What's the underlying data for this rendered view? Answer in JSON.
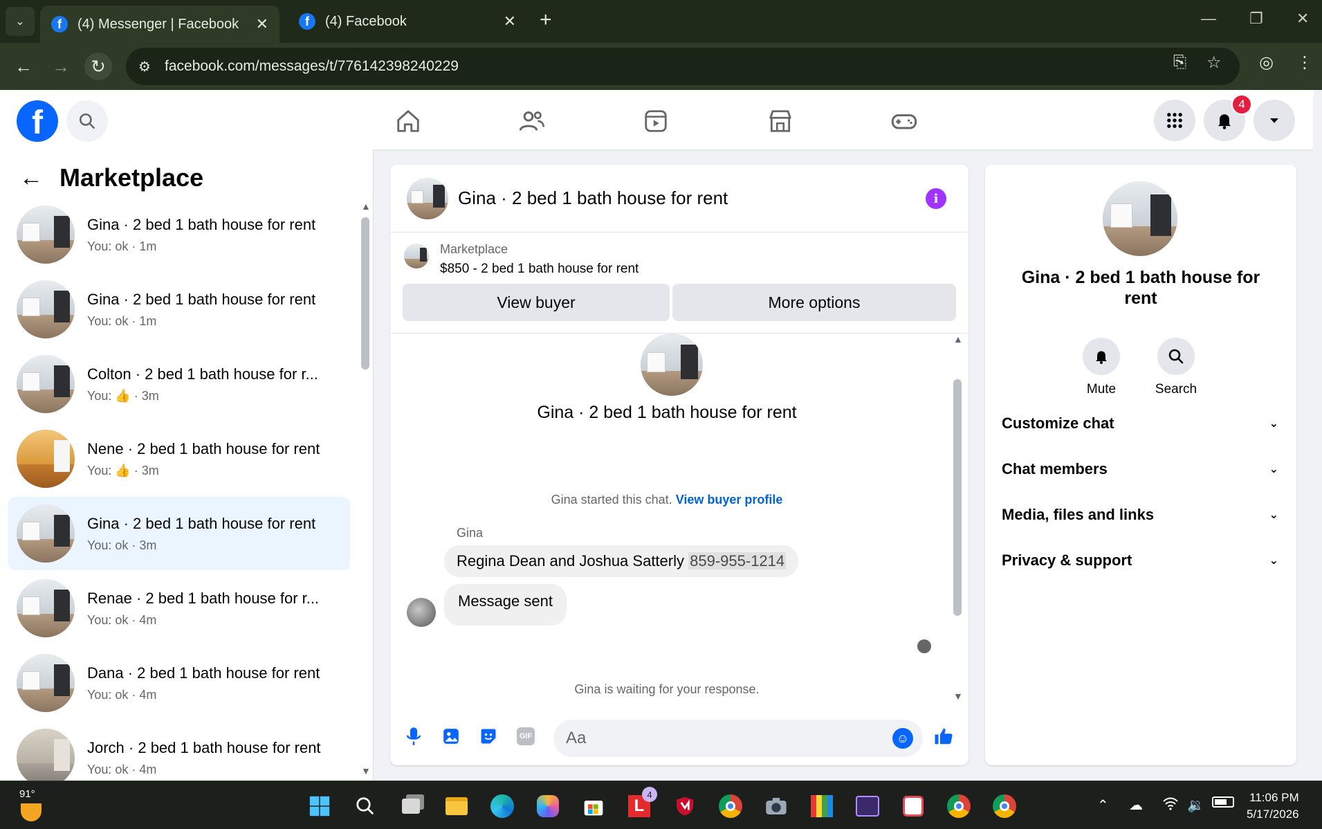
{
  "browser": {
    "tabs": [
      {
        "title": "(4) Messenger | Facebook",
        "active": true
      },
      {
        "title": "(4) Facebook",
        "active": false
      }
    ],
    "url": "facebook.com/messages/t/776142398240229"
  },
  "header": {
    "notifications_count": "4",
    "nav": [
      "home-icon",
      "friends-icon",
      "video-icon",
      "marketplace-icon",
      "gaming-icon"
    ]
  },
  "left": {
    "title": "Marketplace",
    "conversations": [
      {
        "name": "Gina · 2 bed 1 bath house for rent",
        "preview": "You: ok · 1m",
        "selected": false
      },
      {
        "name": "Gina · 2 bed 1 bath house for rent",
        "preview": "You: ok · 1m",
        "selected": false
      },
      {
        "name": "Colton · 2 bed 1 bath house for r...",
        "preview": "You: 👍 · 3m",
        "selected": false
      },
      {
        "name": "Nene · 2 bed 1 bath house for rent",
        "preview": "You: 👍 · 3m",
        "selected": false
      },
      {
        "name": "Gina · 2 bed 1 bath house for rent",
        "preview": "You: ok · 3m",
        "selected": true
      },
      {
        "name": "Renae · 2 bed 1 bath house for r...",
        "preview": "You: ok · 4m",
        "selected": false
      },
      {
        "name": "Dana · 2 bed 1 bath house for rent",
        "preview": "You: ok · 4m",
        "selected": false
      },
      {
        "name": "Jorch · 2 bed 1 bath house for rent",
        "preview": "You: ok · 4m",
        "selected": false
      }
    ]
  },
  "chat": {
    "title": "Gina · 2 bed 1 bath house for rent",
    "listing": {
      "label": "Marketplace",
      "price_title": "$850 - 2 bed 1 bath house for rent",
      "view_buyer": "View buyer",
      "more_options": "More options"
    },
    "intro_title": "Gina · 2 bed 1 bath house for rent",
    "started_text": "Gina started this chat.",
    "started_link": "View buyer profile",
    "sender": "Gina",
    "message1_text": "Regina Dean and Joshua Satterly",
    "message1_phone": "859-955-1214",
    "message2": "Message sent",
    "waiting": "Gina is waiting for your response.",
    "composer_placeholder": "Aa"
  },
  "right": {
    "name": "Gina · 2 bed 1 bath house for rent",
    "mute": "Mute",
    "search": "Search",
    "sections": [
      "Customize chat",
      "Chat members",
      "Media, files and links",
      "Privacy & support"
    ]
  },
  "taskbar": {
    "temperature": "91°",
    "time": "11:06 PM",
    "date": "5/17/2026",
    "badge_count": "4"
  }
}
